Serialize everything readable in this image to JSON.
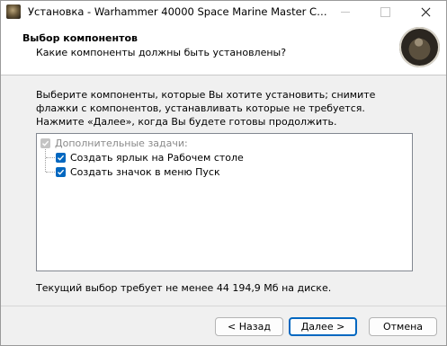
{
  "window": {
    "title": "Установка - Warhammer 40000 Space Marine Master Crafted..."
  },
  "header": {
    "title": "Выбор компонентов",
    "subtitle": "Какие компоненты должны быть установлены?"
  },
  "body": {
    "description": "Выберите компоненты, которые Вы хотите установить; снимите флажки с компонентов, устанавливать которые не требуется. Нажмите «Далее», когда Вы будете готовы продолжить.",
    "components": {
      "group": {
        "label": "Дополнительные задачи:",
        "checked": true,
        "enabled": false
      },
      "items": [
        {
          "label": "Создать ярлык на Рабочем столе",
          "checked": true
        },
        {
          "label": "Создать значок в меню Пуск",
          "checked": true
        }
      ]
    },
    "disk_info": "Текущий выбор требует не менее 44 194,9 Мб на диске."
  },
  "buttons": {
    "back": "< Назад",
    "next": "Далее >",
    "cancel": "Отмена"
  },
  "colors": {
    "accent": "#0067c0",
    "disabled": "#c4c4c4"
  }
}
